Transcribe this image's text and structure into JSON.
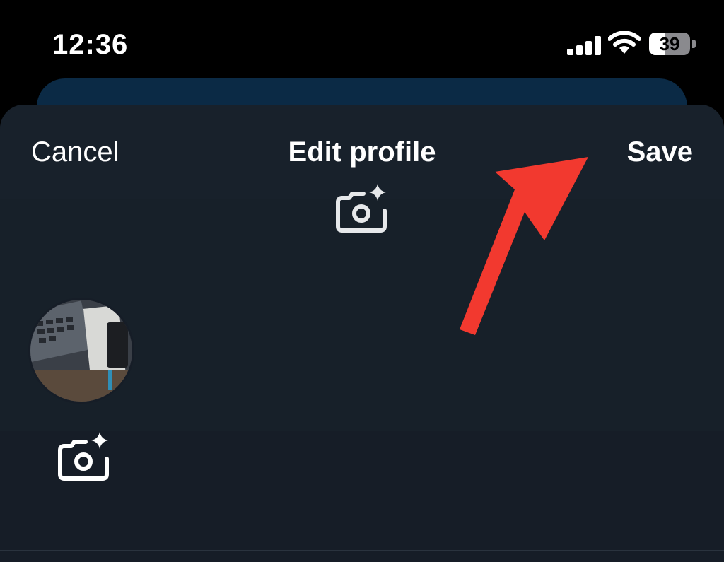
{
  "status_bar": {
    "time": "12:36",
    "battery_level": "39",
    "battery_fraction": 0.39,
    "signal_bars": 4
  },
  "nav": {
    "cancel_label": "Cancel",
    "title": "Edit profile",
    "save_label": "Save"
  },
  "icons": {
    "banner": "camera-plus-icon",
    "avatar": "camera-plus-icon",
    "annotation": "red-arrow"
  },
  "colors": {
    "background": "#000000",
    "sheet": "#161d27",
    "nav_bar": "#18212b",
    "background_card": "#0b2a45",
    "annotation_arrow": "#f2392f",
    "text": "#ffffff"
  }
}
